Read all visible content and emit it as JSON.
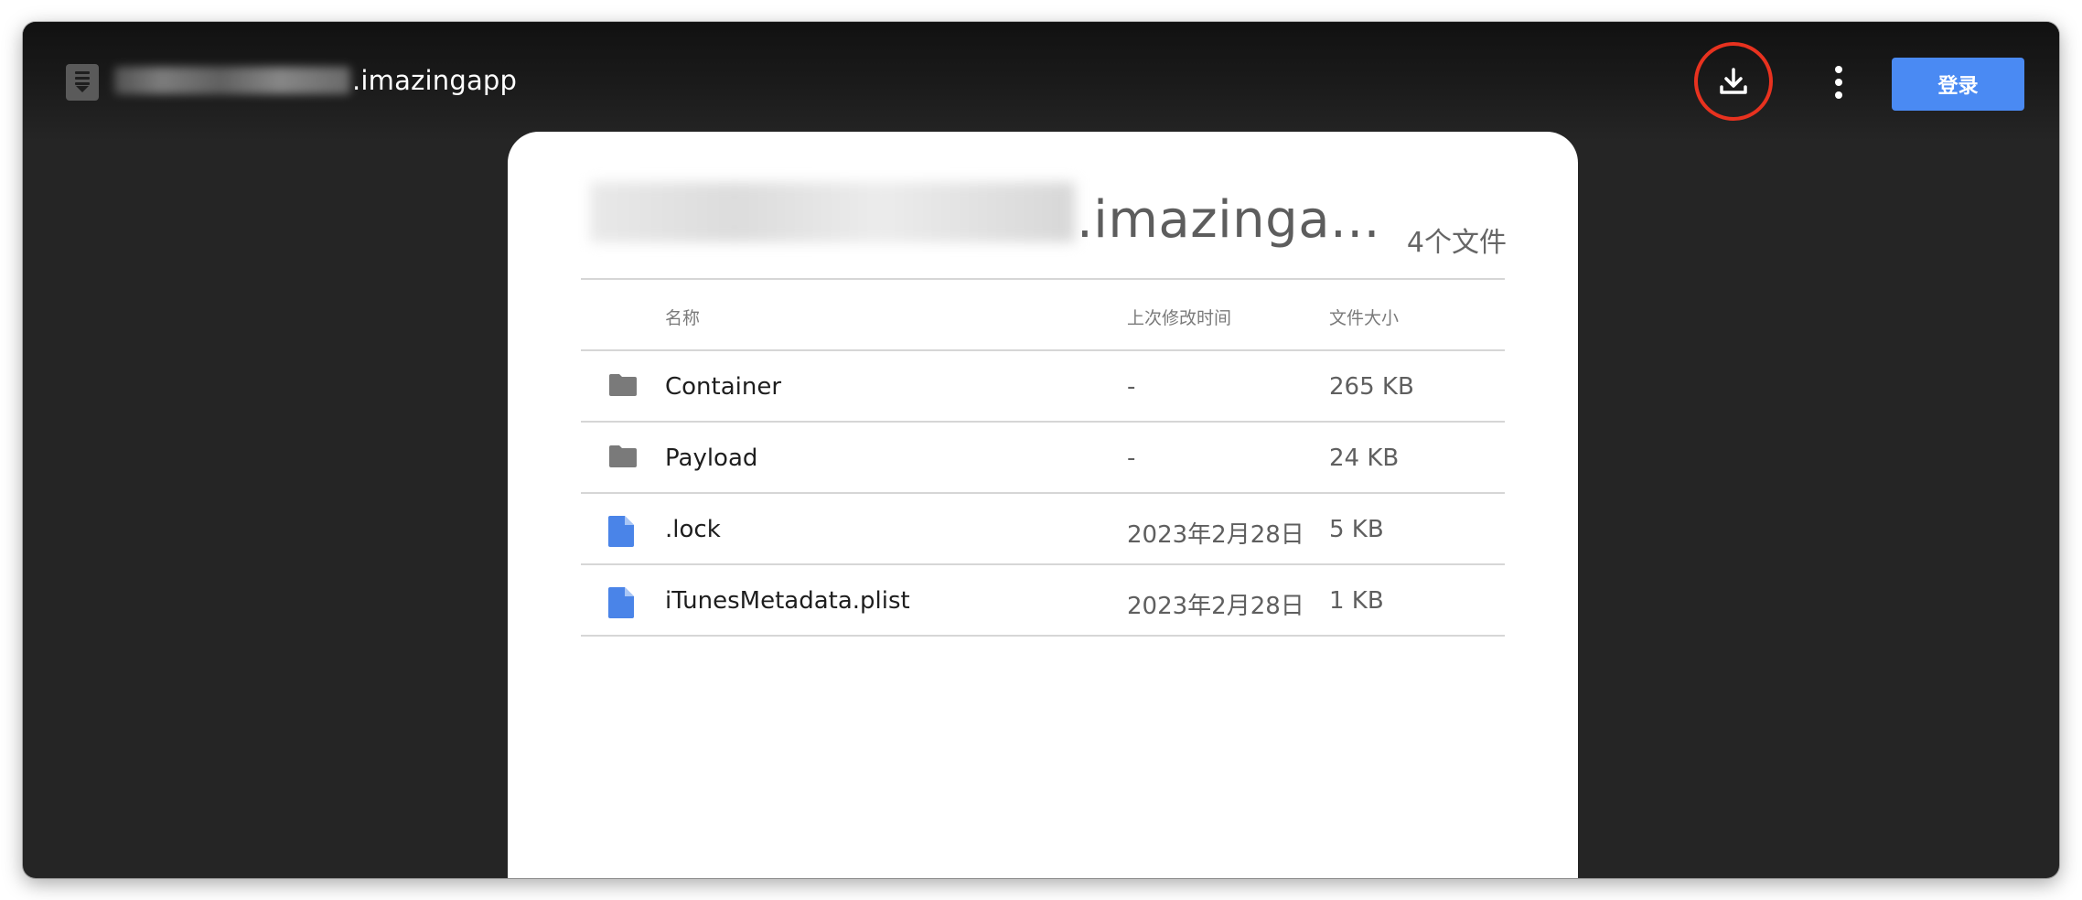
{
  "topbar": {
    "title": ".imazingapp",
    "login_label": "登录"
  },
  "panel": {
    "title": ".imazinga...",
    "file_count": "4个文件"
  },
  "table": {
    "headers": {
      "name": "名称",
      "modified": "上次修改时间",
      "size": "文件大小"
    },
    "rows": [
      {
        "icon": "folder-icon",
        "name": "Container",
        "modified": "-",
        "size": "265 KB"
      },
      {
        "icon": "folder-icon",
        "name": "Payload",
        "modified": "-",
        "size": "24 KB"
      },
      {
        "icon": "document-icon",
        "name": ".lock",
        "modified": "2023年2月28日",
        "size": "5 KB"
      },
      {
        "icon": "document-icon",
        "name": "iTunesMetadata.plist",
        "modified": "2023年2月28日",
        "size": "1 KB"
      }
    ]
  },
  "colors": {
    "window_bg": "#252525",
    "topbar_bg": "#111111",
    "login_button": "#4a8af3",
    "highlight_circle": "#e8321f",
    "folder_icon": "#7a7a7a",
    "document_icon": "#4a84e8",
    "panel_bg": "#ffffff"
  }
}
